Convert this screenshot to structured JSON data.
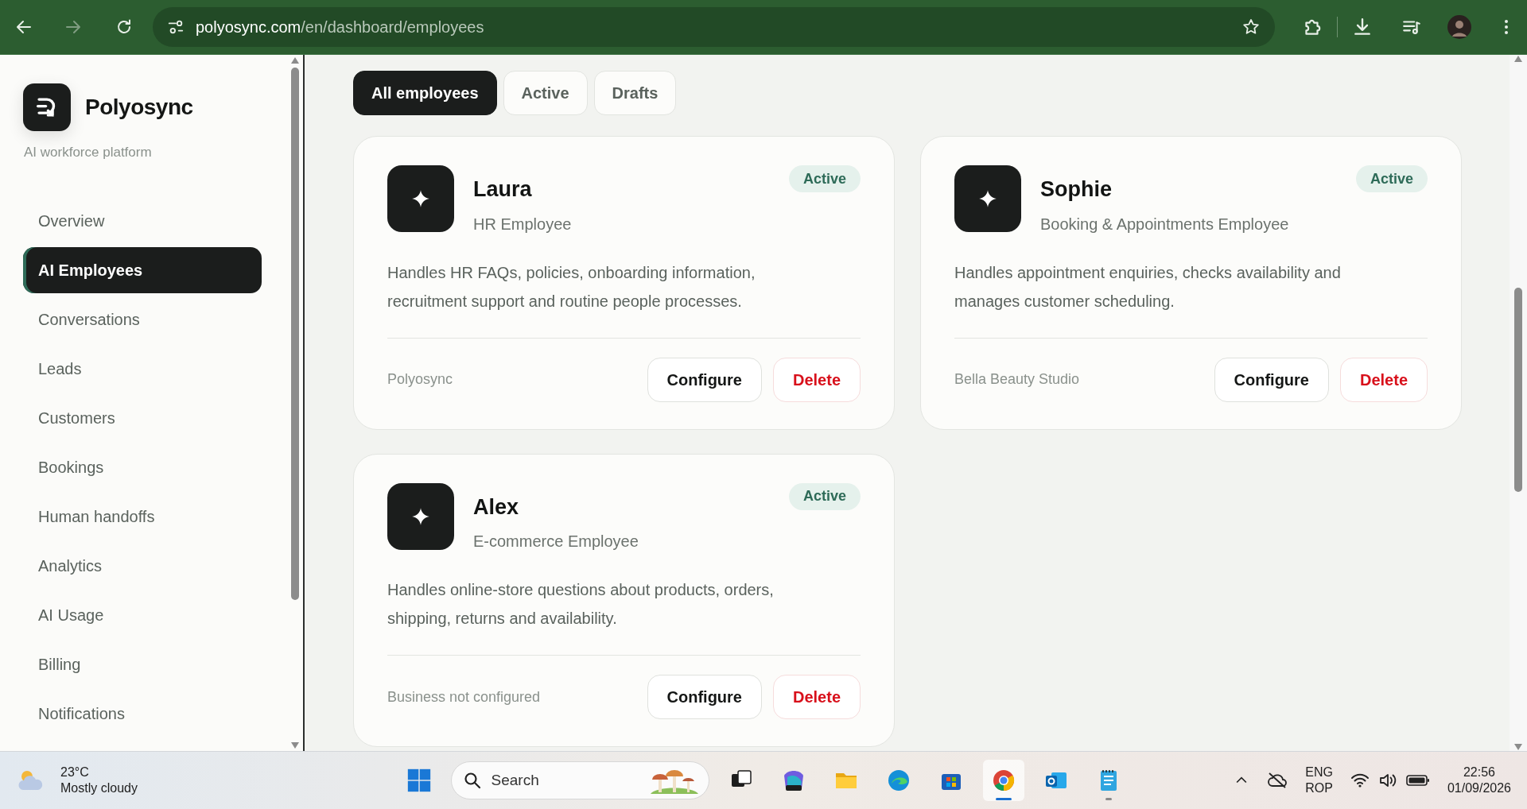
{
  "browser": {
    "url_host": "polyosync.com",
    "url_path": "/en/dashboard/employees",
    "forward_disabled": true
  },
  "sidebar": {
    "brand": "Polyosync",
    "tagline": "AI workforce platform",
    "items": [
      {
        "label": "Overview",
        "selected": false
      },
      {
        "label": "AI Employees",
        "selected": true
      },
      {
        "label": "Conversations",
        "selected": false
      },
      {
        "label": "Leads",
        "selected": false
      },
      {
        "label": "Customers",
        "selected": false
      },
      {
        "label": "Bookings",
        "selected": false
      },
      {
        "label": "Human handoffs",
        "selected": false
      },
      {
        "label": "Analytics",
        "selected": false
      },
      {
        "label": "AI Usage",
        "selected": false
      },
      {
        "label": "Billing",
        "selected": false
      },
      {
        "label": "Notifications",
        "selected": false
      }
    ]
  },
  "filters": [
    {
      "label": "All employees",
      "selected": true
    },
    {
      "label": "Active",
      "selected": false
    },
    {
      "label": "Drafts",
      "selected": false
    }
  ],
  "employees": [
    {
      "name": "Laura",
      "role": "HR Employee",
      "status": "Active",
      "description": "Handles HR FAQs, policies, onboarding information, recruitment support and routine people processes.",
      "business": "Polyosync",
      "actions": [
        {
          "label": "Configure",
          "kind": "configure"
        },
        {
          "label": "Delete",
          "kind": "delete"
        }
      ]
    },
    {
      "name": "Sophie",
      "role": "Booking & Appointments Employee",
      "status": "Active",
      "description": "Handles appointment enquiries, checks availability and manages customer scheduling.",
      "business": "Bella Beauty Studio",
      "actions": [
        {
          "label": "Configure",
          "kind": "configure"
        },
        {
          "label": "Delete",
          "kind": "delete"
        }
      ]
    },
    {
      "name": "Alex",
      "role": "E-commerce Employee",
      "status": "Active",
      "description": "Handles online-store questions about products, orders, shipping, returns and availability.",
      "business": "Business not configured",
      "actions": [
        {
          "label": "Configure",
          "kind": "configure"
        },
        {
          "label": "Delete",
          "kind": "delete"
        }
      ]
    }
  ],
  "taskbar": {
    "weather": {
      "temperature": "23°C",
      "condition": "Mostly cloudy"
    },
    "search_placeholder": "Search",
    "apps": [
      {
        "kind": "taskview",
        "open": false,
        "selected": false
      },
      {
        "kind": "m365",
        "open": false,
        "selected": false
      },
      {
        "kind": "files",
        "open": false,
        "selected": false
      },
      {
        "kind": "edge",
        "open": false,
        "selected": false
      },
      {
        "kind": "store",
        "open": false,
        "selected": false
      },
      {
        "kind": "chrome",
        "open": true,
        "selected": true
      },
      {
        "kind": "outlook",
        "open": false,
        "selected": false
      },
      {
        "kind": "notepad",
        "open": true,
        "selected": false
      }
    ],
    "language": "ENG",
    "layout": "ROP",
    "time": "22:56",
    "date": "01/09/2026"
  }
}
